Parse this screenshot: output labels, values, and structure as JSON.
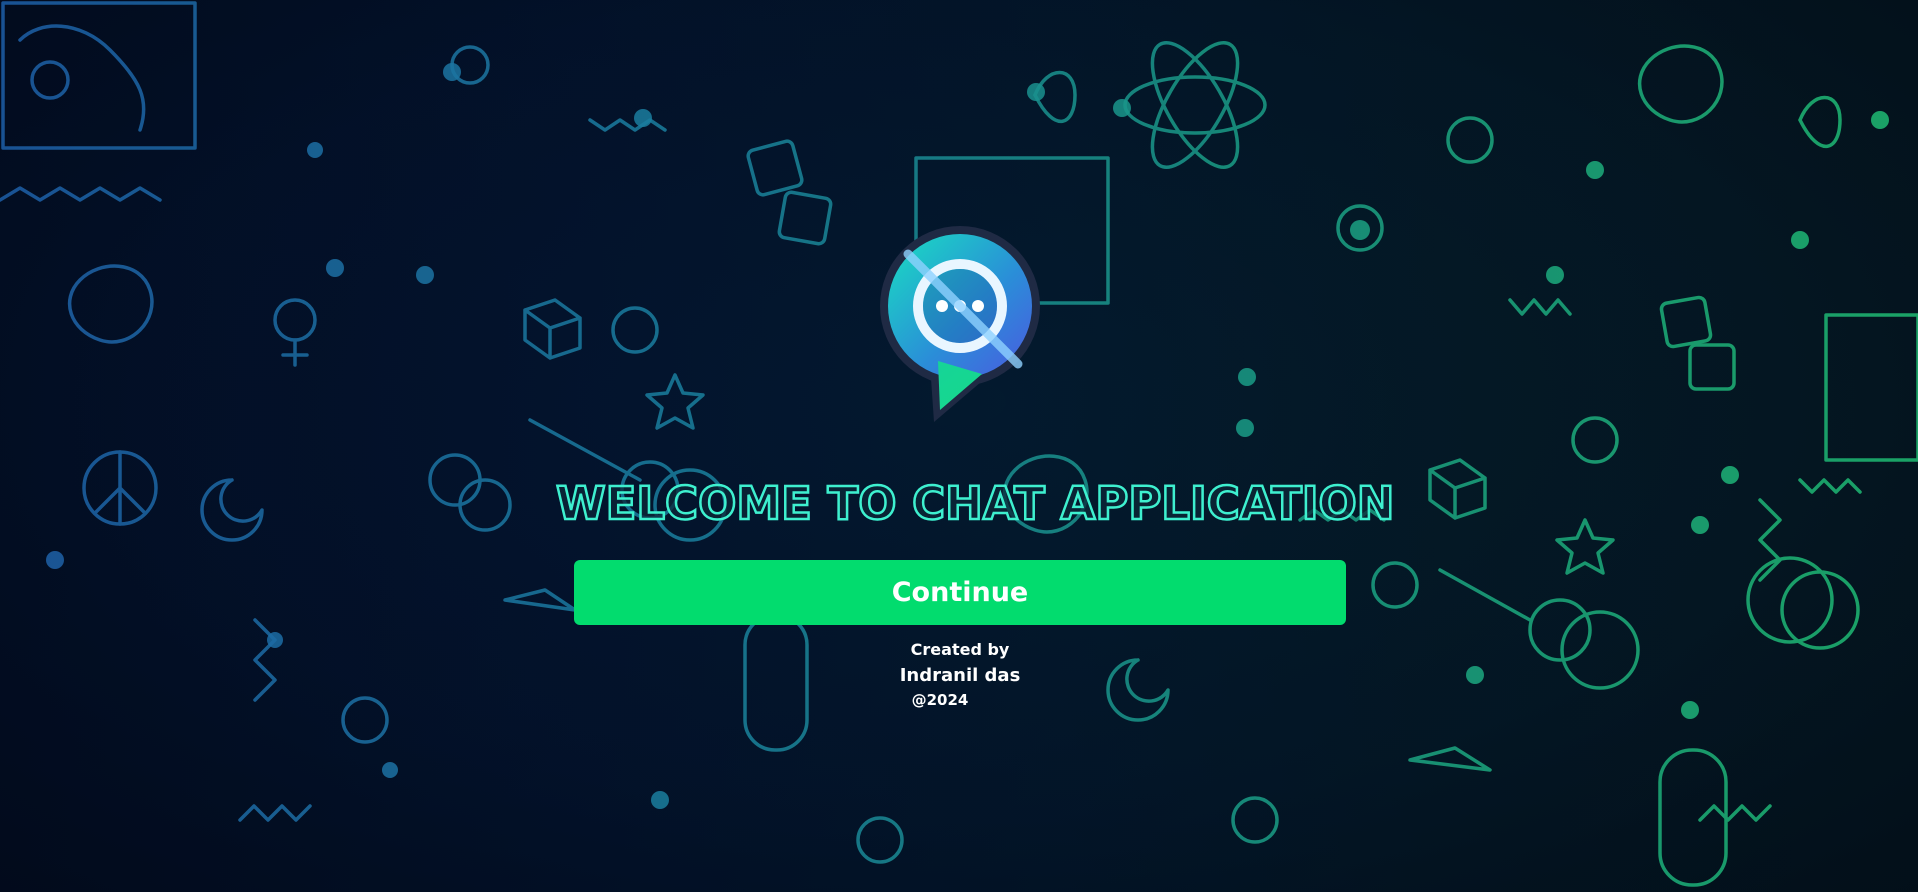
{
  "welcome": {
    "title": "WELCOME TO CHAT APPLICATION"
  },
  "actions": {
    "continue_label": "Continue"
  },
  "credits": {
    "created_by": "Created by",
    "author": "Indranil das",
    "year": "@2024"
  },
  "icons": {
    "logo": "chat-bubble-logo-icon"
  },
  "colors": {
    "background": "#020c1e",
    "button": "#02dc6e",
    "title_outline": "#3ef0cf",
    "doodle_left": "#1f6fb0",
    "doodle_right": "#1fb873",
    "text": "#ffffff"
  }
}
